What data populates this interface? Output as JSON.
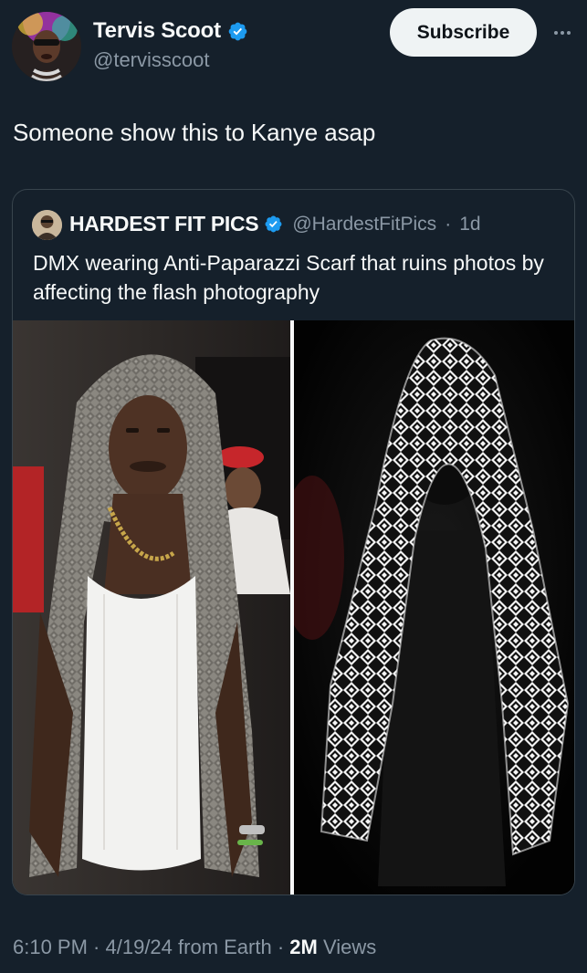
{
  "author": {
    "display_name": "Tervis Scoot",
    "handle": "@tervisscoot",
    "verified_color": "#1d9bf0",
    "avatar_icon": "user-avatar"
  },
  "actions": {
    "subscribe_label": "Subscribe",
    "more_icon": "more-horizontal-icon"
  },
  "tweet": {
    "text": "Someone show this to Kanye asap"
  },
  "quote": {
    "display_name": "HARDEST FIT PICS",
    "handle": "@HardestFitPics",
    "separator": "·",
    "time": "1d",
    "text": "DMX wearing Anti-Paparazzi Scarf that ruins photos by affecting the flash photography",
    "media_left_icon": "photo-scarf-normal",
    "media_right_icon": "photo-scarf-flash"
  },
  "meta": {
    "time": "6:10 PM",
    "sep1": " · ",
    "date": "4/19/24",
    "source": " from Earth",
    "sep2": " · ",
    "views_count": "2M",
    "views_label": " Views"
  },
  "colors": {
    "background": "#15202b",
    "text_primary": "#f7f9f9",
    "text_secondary": "#8b98a5",
    "border": "#38444d",
    "button_bg": "#eff3f4"
  }
}
